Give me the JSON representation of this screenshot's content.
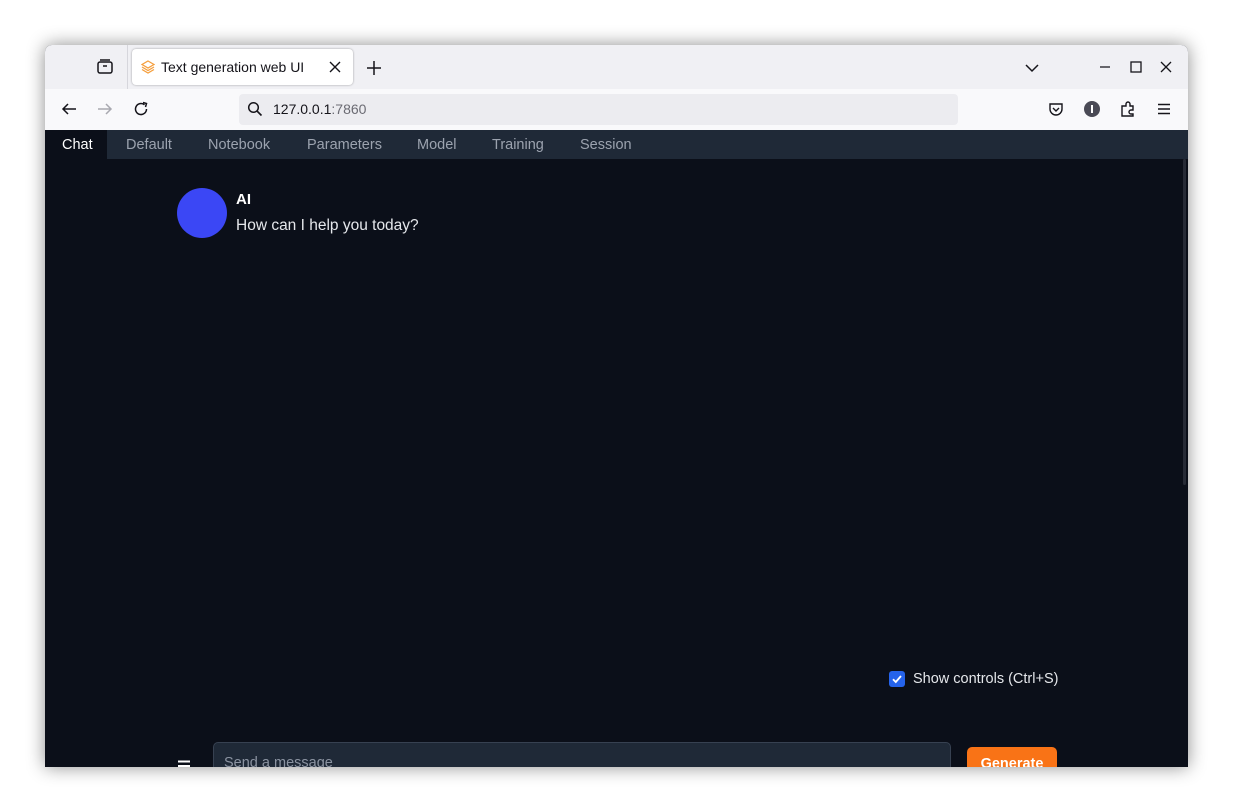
{
  "browser": {
    "tab_title": "Text generation web UI",
    "url_host": "127.0.0.1",
    "url_port": ":7860"
  },
  "app": {
    "tabs": [
      {
        "label": "Chat",
        "active": true
      },
      {
        "label": "Default"
      },
      {
        "label": "Notebook"
      },
      {
        "label": "Parameters"
      },
      {
        "label": "Model"
      },
      {
        "label": "Training"
      },
      {
        "label": "Session"
      }
    ]
  },
  "chat": {
    "messages": [
      {
        "sender": "AI",
        "text": "How can I help you today?",
        "avatar_color": "#3b47f5"
      }
    ],
    "show_controls_label": "Show controls (Ctrl+S)",
    "show_controls_checked": true,
    "input_placeholder": "Send a message",
    "generate_label": "Generate"
  },
  "colors": {
    "background": "#0b0f19",
    "tabbar": "#1f2937",
    "accent": "#f97316",
    "checkbox": "#2563eb"
  },
  "icons": [
    "tabs-icon",
    "favicon-icon",
    "close-icon",
    "plus-icon",
    "chevron-down-icon",
    "minimize-icon",
    "maximize-icon",
    "window-close-icon",
    "back-arrow-icon",
    "forward-arrow-icon",
    "reload-icon",
    "search-icon",
    "pocket-icon",
    "account-icon",
    "extensions-icon",
    "hamburger-menu-icon",
    "menu-icon",
    "checkmark-icon"
  ]
}
